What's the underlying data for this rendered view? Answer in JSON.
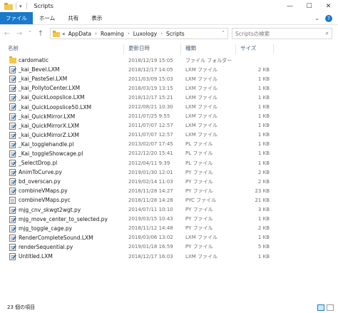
{
  "window": {
    "title": "Scripts",
    "controls": {
      "minimize": "—",
      "maximize": "☐",
      "close": "✕"
    },
    "quick_access_arrow": "▾"
  },
  "ribbon": {
    "tabs": [
      "ファイル",
      "ホーム",
      "共有",
      "表示"
    ],
    "expand_icon": "⌄",
    "help_label": "?"
  },
  "nav": {
    "back": "←",
    "forward": "→",
    "recent": "˅",
    "up": "↑",
    "path_overflow": "«",
    "breadcrumb": [
      "AppData",
      "Roaming",
      "Luxology",
      "Scripts"
    ],
    "chevron": "›",
    "dropdown": "˅",
    "refresh": "↻",
    "search_placeholder": "Scriptsの検索",
    "search_icon": "⌕"
  },
  "columns": {
    "name": "名前",
    "date": "更新日時",
    "type": "種類",
    "size": "サイズ"
  },
  "files": [
    {
      "name": "cardomatic",
      "date": "2018/12/19 15:05",
      "type": "ファイル フォルダー",
      "size": "",
      "icon": "folder-icon"
    },
    {
      "name": "_kai_Bevel.LXM",
      "date": "2018/12/17 14:05",
      "type": "LXM ファイル",
      "size": "2 KB",
      "icon": "script-file-icon"
    },
    {
      "name": "_kai_PasteSel.LXM",
      "date": "2011/03/09 15:03",
      "type": "LXM ファイル",
      "size": "1 KB",
      "icon": "script-file-icon"
    },
    {
      "name": "_kai_PollytoCenter.LXM",
      "date": "2018/03/19 13:15",
      "type": "LXM ファイル",
      "size": "1 KB",
      "icon": "script-file-icon"
    },
    {
      "name": "_kai_QuickLoopslice.LXM",
      "date": "2018/12/17 15:21",
      "type": "LXM ファイル",
      "size": "1 KB",
      "icon": "script-file-icon"
    },
    {
      "name": "_kai_QuickLoopslice50.LXM",
      "date": "2012/08/21 10:30",
      "type": "LXM ファイル",
      "size": "1 KB",
      "icon": "script-file-icon"
    },
    {
      "name": "_kai_QuickMirror.LXM",
      "date": "2011/07/25 9:55",
      "type": "LXM ファイル",
      "size": "1 KB",
      "icon": "script-file-icon"
    },
    {
      "name": "_kai_QuickMirrorX.LXM",
      "date": "2011/07/07 12:57",
      "type": "LXM ファイル",
      "size": "1 KB",
      "icon": "script-file-icon"
    },
    {
      "name": "_kai_QuickMirrorZ.LXM",
      "date": "2011/07/07 12:57",
      "type": "LXM ファイル",
      "size": "1 KB",
      "icon": "script-file-icon"
    },
    {
      "name": "_Kai_togglehandle.pl",
      "date": "2013/02/07 17:45",
      "type": "PL ファイル",
      "size": "1 KB",
      "icon": "script-file-icon"
    },
    {
      "name": "_Kai_toggleShowcage.pl",
      "date": "2012/12/20 15:41",
      "type": "PL ファイル",
      "size": "1 KB",
      "icon": "script-file-icon"
    },
    {
      "name": "_SelectDrop.pl",
      "date": "2012/04/11 9:39",
      "type": "PL ファイル",
      "size": "1 KB",
      "icon": "script-file-icon"
    },
    {
      "name": "AnimToCurve.py",
      "date": "2019/01/30 12:01",
      "type": "PY ファイル",
      "size": "2 KB",
      "icon": "script-file-icon"
    },
    {
      "name": "bd_overscan.py",
      "date": "2019/02/14 11:03",
      "type": "PY ファイル",
      "size": "2 KB",
      "icon": "script-file-icon"
    },
    {
      "name": "combineVMaps.py",
      "date": "2018/11/28 14:27",
      "type": "PY ファイル",
      "size": "23 KB",
      "icon": "script-file-icon"
    },
    {
      "name": "combineVMaps.pyc",
      "date": "2018/11/28 14:28",
      "type": "PYC ファイル",
      "size": "21 KB",
      "icon": "blank-file-icon"
    },
    {
      "name": "mjg_cnv_skwgt2wgt.py",
      "date": "2014/07/11 10:10",
      "type": "PY ファイル",
      "size": "3 KB",
      "icon": "script-file-icon"
    },
    {
      "name": "mjg_move_center_to_selected.py",
      "date": "2019/03/15 10:43",
      "type": "PY ファイル",
      "size": "1 KB",
      "icon": "script-file-icon"
    },
    {
      "name": "mjg_toggle_cage.py",
      "date": "2018/11/12 14:48",
      "type": "PY ファイル",
      "size": "2 KB",
      "icon": "script-file-icon"
    },
    {
      "name": "RenderCompleteSound.LXM",
      "date": "2018/03/06 13:02",
      "type": "LXM ファイル",
      "size": "1 KB",
      "icon": "script-file-icon"
    },
    {
      "name": "renderSequential.py",
      "date": "2019/01/18 16:59",
      "type": "PY ファイル",
      "size": "5 KB",
      "icon": "script-file-icon"
    },
    {
      "name": "Untitled.LXM",
      "date": "2018/12/17 16:03",
      "type": "LXM ファイル",
      "size": "1 KB",
      "icon": "script-file-icon"
    }
  ],
  "status": {
    "item_count": "23 個の項目"
  },
  "colors": {
    "accent": "#1979ca",
    "folder": "#f3c74e",
    "header_text": "#4c607a",
    "secondary_text": "#6d6d6d"
  }
}
